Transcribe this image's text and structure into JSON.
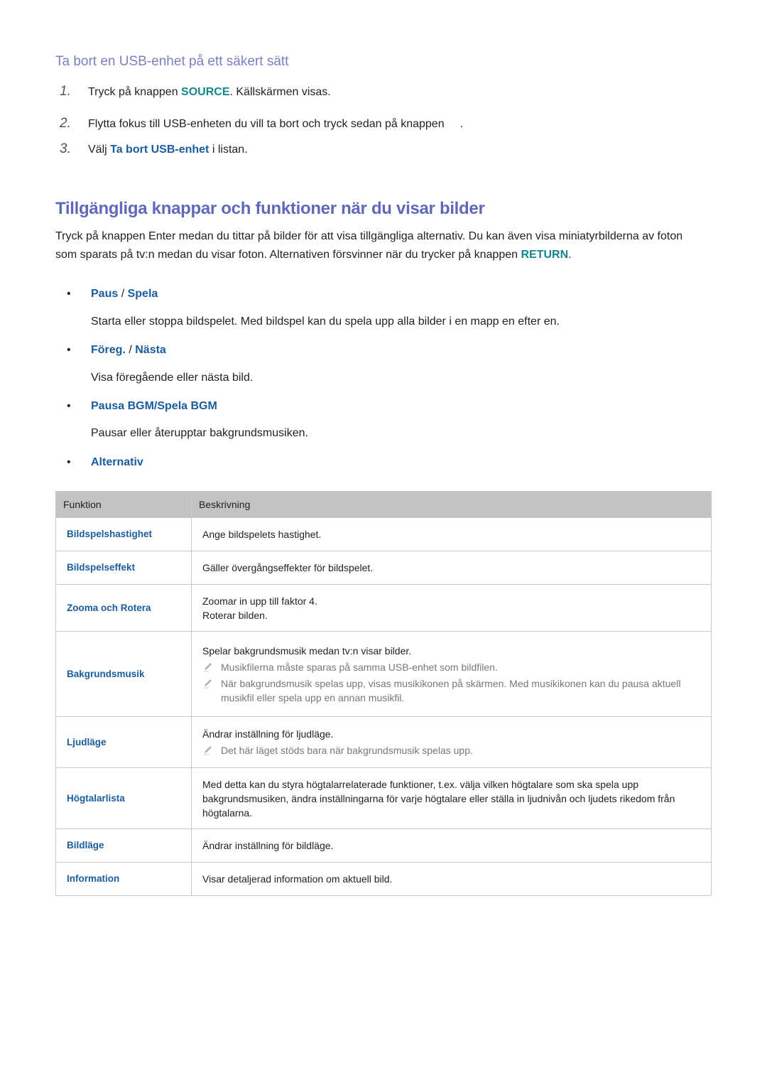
{
  "section1": {
    "title": "Ta bort en USB-enhet på ett säkert sätt",
    "steps": [
      {
        "num": "1.",
        "pre": "Tryck på knappen ",
        "kw": "SOURCE",
        "post": ". Källskärmen visas."
      },
      {
        "num": "2.",
        "pre": "Flytta fokus till USB-enheten du vill ta bort och tryck sedan på knappen",
        "kw": "",
        "post": "     ."
      },
      {
        "num": "3.",
        "pre": "Välj ",
        "kw": "Ta bort USB-enhet",
        "post": " i listan."
      }
    ]
  },
  "section2": {
    "title": "Tillgängliga knappar och funktioner när du visar bilder",
    "intro_pre": "Tryck på knappen Enter medan du tittar på bilder för att visa tillgängliga alternativ. Du kan även visa miniatyrbilderna av foton som sparats på tv:n medan du visar foton. Alternativen försvinner när du trycker på knappen ",
    "intro_kw": "RETURN",
    "intro_post": ".",
    "bullets": [
      {
        "a": "Paus",
        "sep": " / ",
        "b": "Spela",
        "desc": "Starta eller stoppa bildspelet. Med bildspel kan du spela upp alla bilder i en mapp en efter en."
      },
      {
        "a": "Föreg.",
        "sep": " / ",
        "b": "Nästa",
        "desc": "Visa föregående eller nästa bild."
      },
      {
        "a": "Pausa BGM/Spela BGM",
        "sep": "",
        "b": "",
        "desc": "Pausar eller återupptar bakgrundsmusiken."
      },
      {
        "a": "Alternativ",
        "sep": "",
        "b": "",
        "desc": ""
      }
    ]
  },
  "table": {
    "headers": [
      "Funktion",
      "Beskrivning"
    ],
    "rows": [
      {
        "fn": "Bildspelshastighet",
        "desc": [
          "Ange bildspelets hastighet."
        ],
        "notes": []
      },
      {
        "fn": "Bildspelseffekt",
        "desc": [
          "Gäller övergångseffekter för bildspelet."
        ],
        "notes": []
      },
      {
        "fn": "Zooma och Rotera",
        "desc": [
          "Zoomar in upp till faktor 4.",
          "Roterar bilden."
        ],
        "notes": []
      },
      {
        "fn": "Bakgrundsmusik",
        "desc": [
          "Spelar bakgrundsmusik medan tv:n visar bilder."
        ],
        "notes": [
          "Musikfilerna måste sparas på samma USB-enhet som bildfilen.",
          "När bakgrundsmusik spelas upp, visas musikikonen på skärmen. Med musikikonen kan du pausa aktuell musikfil eller spela upp en annan musikfil."
        ]
      },
      {
        "fn": "Ljudläge",
        "desc": [
          "Ändrar inställning för ljudläge."
        ],
        "notes": [
          "Det här läget stöds bara när bakgrundsmusik spelas upp."
        ]
      },
      {
        "fn": "Högtalarlista",
        "desc": [
          "Med detta kan du styra högtalarrelaterade funktioner, t.ex. välja vilken högtalare som ska spela upp bakgrundsmusiken, ändra inställningarna för varje högtalare eller ställa in ljudnivån och ljudets rikedom från högtalarna."
        ],
        "notes": []
      },
      {
        "fn": "Bildläge",
        "desc": [
          "Ändrar inställning för bildläge."
        ],
        "notes": []
      },
      {
        "fn": "Information",
        "desc": [
          "Visar detaljerad information om aktuell bild."
        ],
        "notes": []
      }
    ]
  },
  "icons": {
    "note": "pencil-note-icon"
  },
  "colors": {
    "heading": "#6068ba",
    "subheading": "#7a7fbf",
    "keyword_teal": "#13858f",
    "keyword_blue": "#1a5c9e",
    "table_header_bg": "#c3c3c3"
  }
}
